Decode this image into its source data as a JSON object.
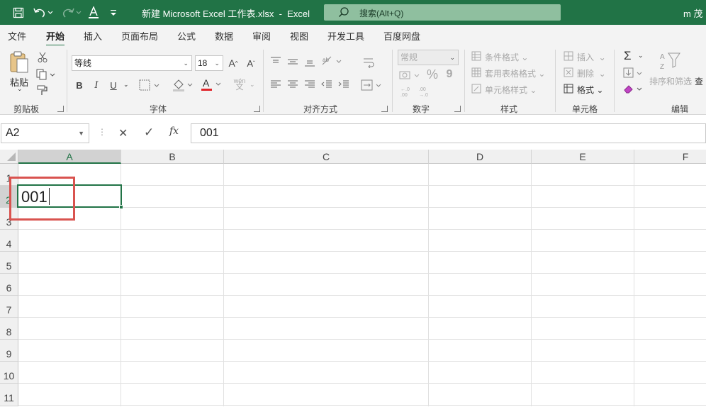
{
  "title_bar": {
    "filename": "新建 Microsoft Excel 工作表.xlsx",
    "separator": "-",
    "app": "Excel",
    "search_placeholder": "搜索(Alt+Q)",
    "user": "m 茂",
    "accent": "#217346"
  },
  "menu": {
    "tabs": [
      "文件",
      "开始",
      "插入",
      "页面布局",
      "公式",
      "数据",
      "审阅",
      "视图",
      "开发工具",
      "百度网盘"
    ],
    "active": "开始"
  },
  "ribbon": {
    "clipboard": {
      "paste": "粘贴",
      "label": "剪贴板"
    },
    "font": {
      "name": "等线",
      "size": "18",
      "bold": "B",
      "italic": "I",
      "underline": "U",
      "grow": "A^",
      "shrink": "A˅",
      "color_letter": "A",
      "phonetic": "wén",
      "label": "字体"
    },
    "alignment": {
      "label": "对齐方式"
    },
    "number": {
      "format": "常规",
      "percent": "%",
      "comma": "9",
      "label": "数字"
    },
    "styles": {
      "conditional": "条件格式",
      "table": "套用表格格式",
      "cell": "单元格样式",
      "label": "样式"
    },
    "cells": {
      "insert": "插入",
      "delete": "删除",
      "format": "格式",
      "label": "单元格"
    },
    "editing": {
      "sigma": "Σ",
      "sort": "排序和筛选",
      "find": "查",
      "label": "编辑"
    }
  },
  "formula_bar": {
    "name_box": "A2",
    "cancel": "✕",
    "enter": "✓",
    "fx": "fx",
    "content": "001"
  },
  "grid": {
    "columns": [
      "A",
      "B",
      "C",
      "D",
      "E",
      "F"
    ],
    "rows": [
      "1",
      "2",
      "3",
      "4",
      "5",
      "6",
      "7",
      "8",
      "9",
      "10",
      "11"
    ],
    "active_cell": "A2",
    "active_value": "001",
    "highlight_color": "#d9534f"
  }
}
